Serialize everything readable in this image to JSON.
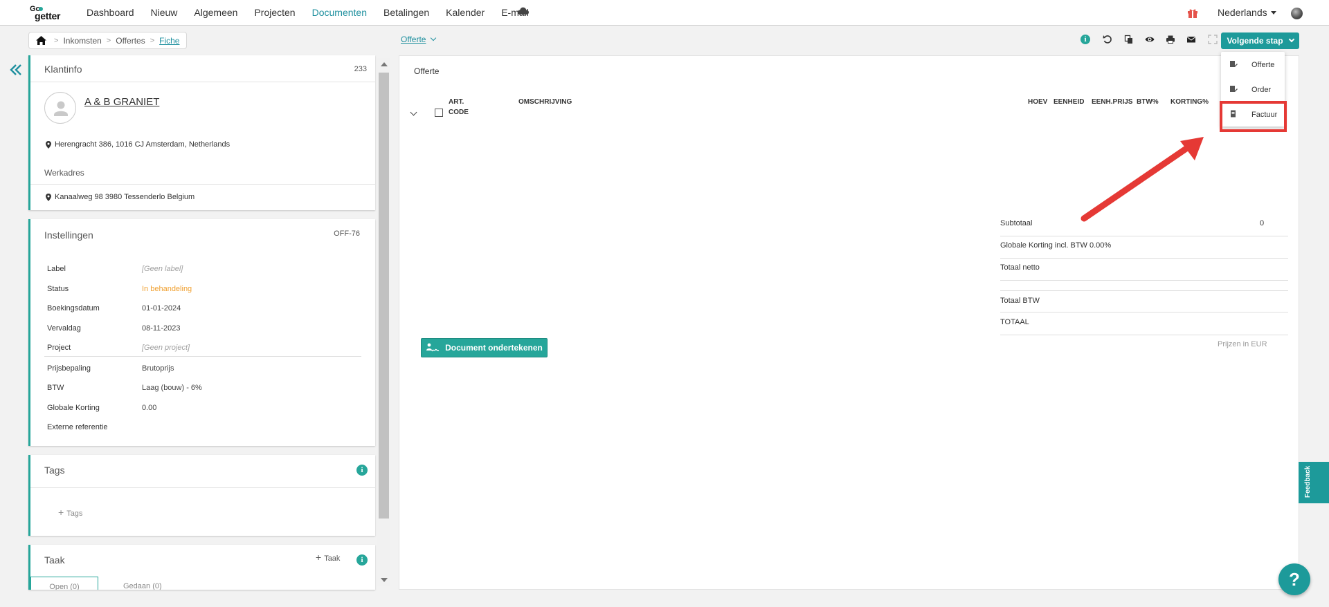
{
  "nav": {
    "items": [
      "Dashboard",
      "Nieuw",
      "Algemeen",
      "Projecten",
      "Documenten",
      "Betalingen",
      "Kalender",
      "E-mail"
    ],
    "active": "Documenten",
    "language": "Nederlands",
    "logo_top": "Go",
    "logo_bottom": "getter"
  },
  "breadcrumb": [
    "Inkomsten",
    "Offertes",
    "Fiche"
  ],
  "doc_type_select": "Offerte",
  "next_step_label": "Volgende stap",
  "next_step_menu": [
    "Offerte",
    "Order",
    "Factuur"
  ],
  "client": {
    "title": "Klantinfo",
    "number": "233",
    "name": "A & B GRANIET",
    "address": "Herengracht 386, 1016 CJ Amsterdam, Netherlands",
    "work_address_title": "Werkadres",
    "work_address": "Kanaalweg 98 3980 Tessenderlo Belgium"
  },
  "settings": {
    "title": "Instellingen",
    "code": "OFF-76",
    "rows": [
      {
        "label": "Label",
        "value": "[Geen label]"
      },
      {
        "label": "Status",
        "value": "In behandeling"
      },
      {
        "label": "Boekingsdatum",
        "value": "01-01-2024"
      },
      {
        "label": "Vervaldag",
        "value": "08-11-2023"
      },
      {
        "label": "Project",
        "value": "[Geen project]"
      },
      {
        "label": "Prijsbepaling",
        "value": "Brutoprijs"
      },
      {
        "label": "BTW",
        "value": "Laag (bouw) - 6%"
      },
      {
        "label": "Globale Korting",
        "value": "0.00"
      },
      {
        "label": "Externe referentie",
        "value": ""
      }
    ]
  },
  "tags": {
    "title": "Tags",
    "add_label": "Tags"
  },
  "task": {
    "title": "Taak",
    "add_label": "Taak",
    "tab_open": "Open (0)",
    "tab_done": "Gedaan (0)"
  },
  "document": {
    "title": "Offerte",
    "columns": [
      "ART. CODE",
      "OMSCHRIJVING",
      "HOEV",
      "EENHEID",
      "EENH.PRIJS",
      "BTW%",
      "KORTING%"
    ],
    "col_art": "ART.",
    "col_code": "CODE",
    "totals": [
      {
        "label": "Subtotaal",
        "value": "0"
      },
      {
        "label": "Globale Korting incl. BTW 0.00%",
        "value": ""
      },
      {
        "label": "Totaal netto",
        "value": ""
      },
      {
        "label": "Totaal BTW",
        "value": ""
      },
      {
        "label": "TOTAAL",
        "value": ""
      }
    ],
    "currency_note": "Prijzen in EUR",
    "sign_button": "Document ondertekenen"
  },
  "feedback_label": "Feedback",
  "help_label": "?",
  "colors": {
    "accent": "#26a69a",
    "primary_button": "#1d9a9a",
    "status_orange": "#f0a030",
    "highlight_red": "#e53935"
  },
  "icons": {
    "info": "i",
    "plus": "+"
  }
}
